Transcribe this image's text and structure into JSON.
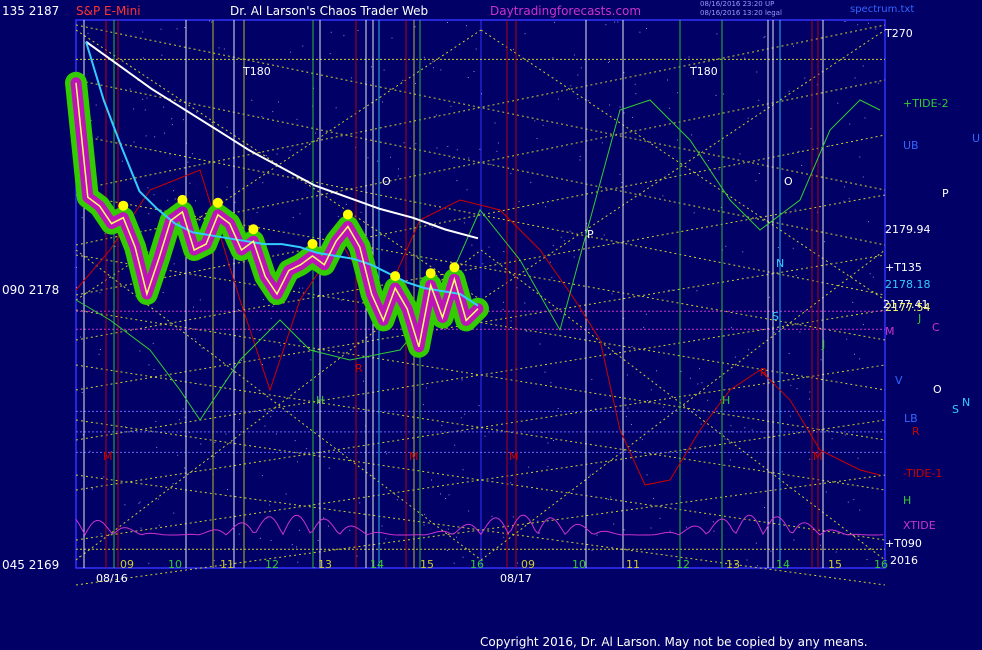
{
  "header": {
    "left_price": "135  2187",
    "symbol": "S&P E-Mini",
    "title": "Dr. Al Larson's Chaos Trader Web",
    "site": "Daytradingforecasts.com",
    "stamp1": "08/16/2016 23:20 UP",
    "stamp2": "08/16/2016 13:20 legal",
    "file": "spectrum.txt"
  },
  "yaxis": {
    "mid": "090  2178",
    "bottom": "045  2169"
  },
  "colors": {
    "background": "#000066",
    "price": "#ffff66",
    "glow_green": "#33cc00",
    "glow_magenta": "#cc00cc",
    "fast_avg": "#33ccff",
    "slow_avg": "#ffffff",
    "tide1": "#cc0000",
    "tide2": "#33cc33",
    "xtide": "#cc33cc",
    "grid_yellow": "#cccc33",
    "grid_blue": "#3333ff"
  },
  "right_labels": [
    {
      "text": "T270",
      "color": "#ffffff"
    },
    {
      "text": "+TIDE-2",
      "color": "#33cc33"
    },
    {
      "text": "UB",
      "color": "#3366ff"
    },
    {
      "text": "U",
      "color": "#3366ff"
    },
    {
      "text": "P",
      "color": "#ffffff"
    },
    {
      "text": "2179.94",
      "color": "#ffffff"
    },
    {
      "text": "+T135",
      "color": "#ffffff"
    },
    {
      "text": "2178.18",
      "color": "#33ccff"
    },
    {
      "text": "2177.41",
      "color": "#ffffff"
    },
    {
      "text": "2177.54",
      "color": "#ffff66"
    },
    {
      "text": "J",
      "color": "#33cc33"
    },
    {
      "text": "C",
      "color": "#cc33cc"
    },
    {
      "text": "M",
      "color": "#cc33cc"
    },
    {
      "text": "V",
      "color": "#3366ff"
    },
    {
      "text": "O",
      "color": "#ffffff"
    },
    {
      "text": "N",
      "color": "#33ccff"
    },
    {
      "text": "S",
      "color": "#33ccff"
    },
    {
      "text": "LB",
      "color": "#3366ff"
    },
    {
      "text": "R",
      "color": "#cc0000"
    },
    {
      "text": "-TIDE-1",
      "color": "#cc0000"
    },
    {
      "text": "H",
      "color": "#33cc33"
    },
    {
      "text": "XTIDE",
      "color": "#cc33cc"
    },
    {
      "text": "+T090",
      "color": "#ffffff"
    },
    {
      "text": "2016",
      "color": "#ffffff"
    }
  ],
  "chart_labels": {
    "t180": "T180",
    "o": "O",
    "p": "P",
    "n": "N",
    "s": "S",
    "r": "R",
    "h": "H",
    "j": "J",
    "m": "M"
  },
  "chart_data": {
    "type": "line",
    "ylim": [
      2169,
      2187
    ],
    "y_ticks": [
      2169,
      2178,
      2187
    ],
    "y_angles": [
      "045",
      "090",
      "135"
    ],
    "dates": [
      "08/16",
      "08/17"
    ],
    "hour_ticks": [
      "09",
      "10",
      "11",
      "12",
      "13",
      "14",
      "15",
      "16",
      "09",
      "10",
      "11",
      "12",
      "13",
      "14",
      "15",
      "16"
    ],
    "levels": {
      "T270": 2186,
      "2179.94": 2179.94,
      "+T135": 2178.6,
      "2178.18": 2178.18,
      "2177.54": 2177.54,
      "2177.41": 2177.41,
      "+T090": 2169.3
    },
    "series": [
      {
        "name": "price",
        "values": [
          2185.2,
          2181.3,
          2181.0,
          2180.4,
          2180.6,
          2179.6,
          2178.0,
          2179.2,
          2180.5,
          2180.8,
          2179.5,
          2179.7,
          2180.7,
          2180.4,
          2179.5,
          2179.8,
          2178.6,
          2178.0,
          2178.8,
          2179.0,
          2179.3,
          2179.0,
          2179.8,
          2180.3,
          2179.6,
          2178.0,
          2177.1,
          2178.2,
          2177.5,
          2176.2,
          2178.3,
          2177.2,
          2178.5,
          2177.1,
          2177.5
        ]
      },
      {
        "name": "fast avg",
        "values": [
          2186.6,
          2184.6,
          2183.0,
          2181.5,
          2180.9,
          2180.4,
          2180.1,
          2180.0,
          2179.9,
          2179.8,
          2179.7,
          2179.7,
          2179.6,
          2179.4,
          2179.3,
          2179.2,
          2179.0,
          2178.7,
          2178.4,
          2178.2,
          2178.1,
          2178.0,
          2177.6
        ]
      },
      {
        "name": "slow avg",
        "values": [
          2186.6,
          2185.8,
          2185.0,
          2184.3,
          2183.6,
          2182.9,
          2182.3,
          2181.7,
          2181.3,
          2180.9,
          2180.6,
          2180.2,
          2179.9
        ]
      }
    ]
  },
  "footer": {
    "copyright": "Copyright 2016, Dr. Al Larson. May not be copied by any means."
  }
}
